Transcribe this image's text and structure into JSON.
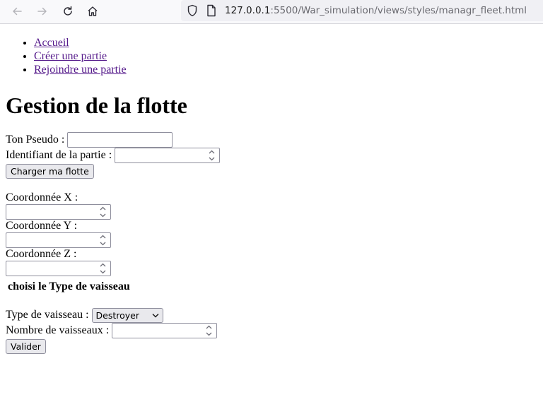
{
  "browser": {
    "url_host": "127.0.0.1",
    "url_path": ":5500/War_simulation/views/styles/managr_fleet.html"
  },
  "nav": {
    "items": [
      {
        "label": "Accueil"
      },
      {
        "label": "Créer une partie"
      },
      {
        "label": "Rejoindre une partie"
      }
    ]
  },
  "page": {
    "title": "Gestion de la flotte"
  },
  "form": {
    "pseudo_label": "Ton Pseudo :",
    "pseudo_value": "",
    "game_id_label": "Identifiant de la partie :",
    "game_id_value": "",
    "load_button": "Charger ma flotte",
    "x_label": "Coordonnée X :",
    "y_label": "Coordonnée Y :",
    "z_label": "Coordonnée Z :",
    "ship_section_title": "choisi le Type de vaisseau",
    "ship_type_label": "Type de vaisseau :",
    "ship_type_selected": "Destroyer",
    "ship_count_label": "Nombre de vaisseaux :",
    "submit_button": "Valider"
  }
}
